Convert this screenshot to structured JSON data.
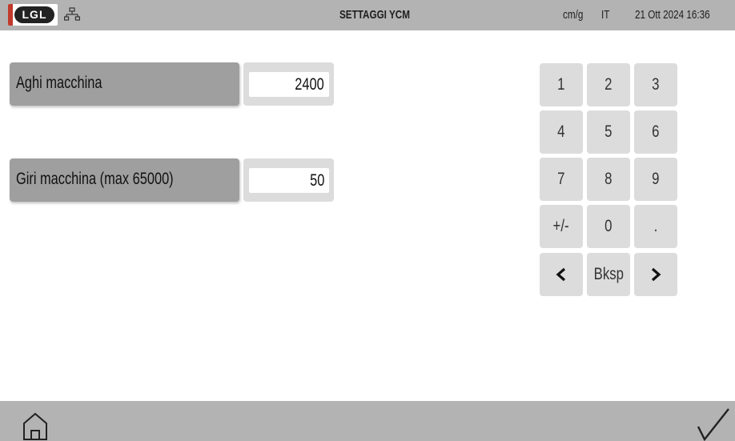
{
  "header": {
    "logo_text": "LGL",
    "network_icon": "network-icon",
    "title": "SETTAGGI YCM",
    "unit": "cm/g",
    "language": "IT",
    "datetime": "21 Ott 2024 16:36"
  },
  "params": [
    {
      "label": "Aghi macchina",
      "value": "2400"
    },
    {
      "label": "Giri macchina (max 65000)",
      "value": "50"
    }
  ],
  "keypad": {
    "k1": "1",
    "k2": "2",
    "k3": "3",
    "k4": "4",
    "k5": "5",
    "k6": "6",
    "k7": "7",
    "k8": "8",
    "k9": "9",
    "sign": "+/-",
    "k0": "0",
    "dot": ".",
    "left_icon": "chevron-left-icon",
    "backspace": "Bksp",
    "right_icon": "chevron-right-icon"
  },
  "footer": {
    "home_icon": "home-icon",
    "confirm_icon": "checkmark-icon"
  },
  "colors": {
    "bar": "#b3b3b3",
    "label_bg": "#9f9f9f",
    "key_bg": "#dcdcdc",
    "logo_accent": "#c0392b"
  }
}
